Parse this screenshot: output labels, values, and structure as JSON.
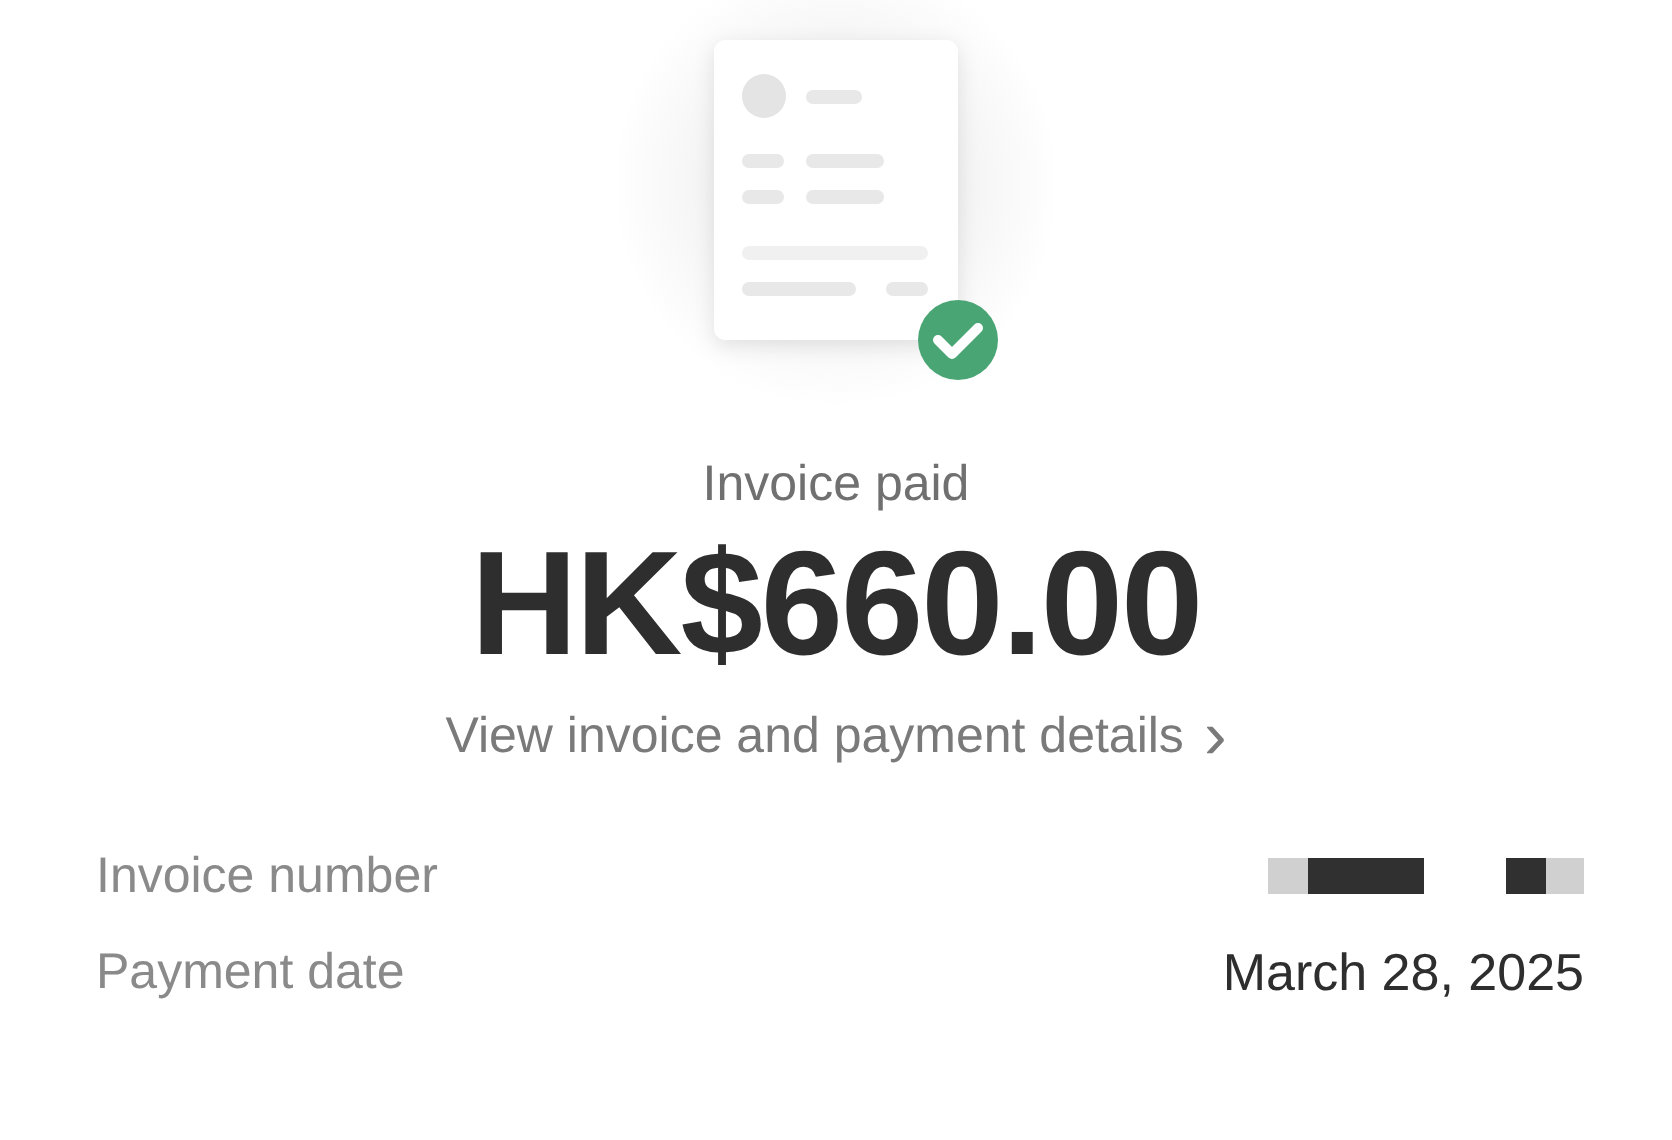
{
  "status": {
    "label": "Invoice paid",
    "paid": true
  },
  "amount": "HK$660.00",
  "details_link": {
    "label": "View invoice and payment details",
    "chevron": "›"
  },
  "rows": [
    {
      "label": "Invoice number",
      "kind": "redacted"
    },
    {
      "label": "Payment date",
      "kind": "text",
      "value": "March 28, 2025"
    }
  ]
}
